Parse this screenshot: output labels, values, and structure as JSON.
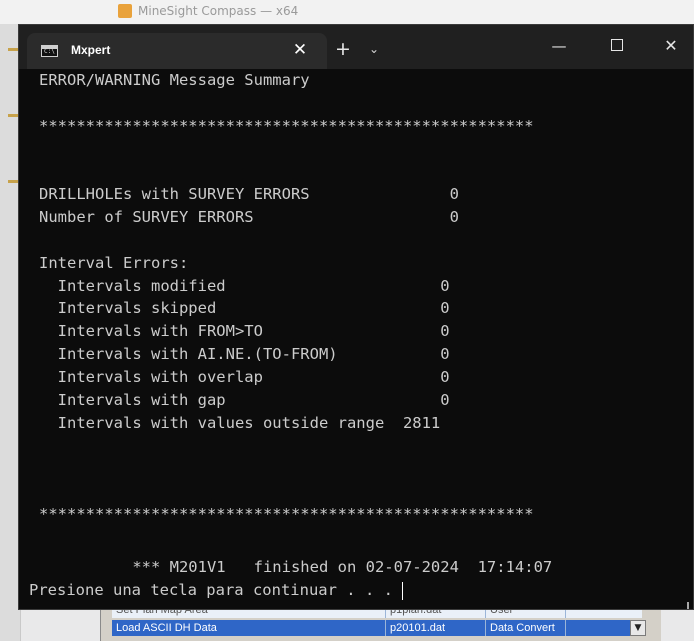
{
  "background_app": {
    "title": "MineSight Compass — x64",
    "rows": [
      {
        "col1": "Set Plan Map Area",
        "col2": "p1plan.dat",
        "col3": "User"
      },
      {
        "col1": "Load ASCII DH Data",
        "col2": "p20101.dat",
        "col3": "Data Convert"
      }
    ]
  },
  "terminal": {
    "tab_title": "Mxpert",
    "tab_close_glyph": "✕",
    "new_tab_glyph": "+",
    "tab_dropdown_glyph": "⌄",
    "minimize_glyph": "—",
    "close_glyph": "✕",
    "lines": [
      "ERROR/WARNING Message Summary",
      "",
      "*****************************************************",
      "",
      "",
      "DRILLHOLEs with SURVEY ERRORS               0",
      "Number of SURVEY ERRORS                     0",
      "",
      "Interval Errors:",
      "  Intervals modified                       0",
      "  Intervals skipped                        0",
      "  Intervals with FROM>TO                   0",
      "  Intervals with AI.NE.(TO-FROM)           0",
      "  Intervals with overlap                   0",
      "  Intervals with gap                       0",
      "  Intervals with values outside range  2811",
      "",
      "",
      "",
      "*****************************************************",
      "",
      "",
      "          *** M201V1   finished on 02-07-2024  17:14:07"
    ],
    "prompt": "Presione una tecla para continuar . . . "
  }
}
